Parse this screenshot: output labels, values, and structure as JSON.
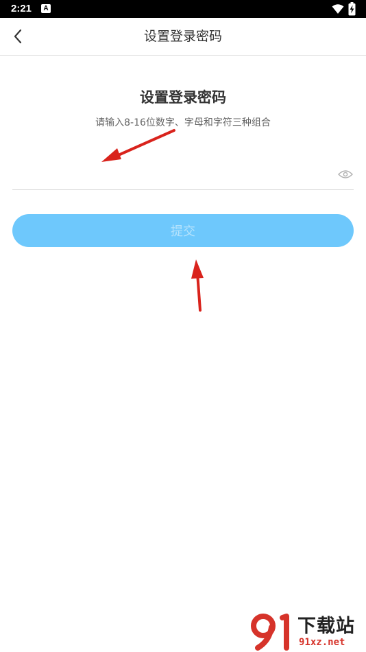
{
  "status_bar": {
    "time": "2:21",
    "app_icon_letter": "A",
    "icons": [
      "wifi-icon",
      "battery-charging-icon"
    ]
  },
  "header": {
    "title": "设置登录密码",
    "back_icon": "chevron-left-icon"
  },
  "main": {
    "title": "设置登录密码",
    "subtitle": "请输入8-16位数字、字母和字符三种组合",
    "password_input": {
      "value": "",
      "placeholder": "",
      "toggle_icon": "eye-icon"
    },
    "submit_label": "提交"
  },
  "colors": {
    "submit_background": "#6ec8fc",
    "submit_text": "#b6e3fc",
    "annotation_arrow": "#d9231c",
    "watermark_accent": "#d6332a"
  },
  "watermark": {
    "title": "下载站",
    "url": "91xz.net",
    "logo_icon": "logo-91-icon"
  }
}
